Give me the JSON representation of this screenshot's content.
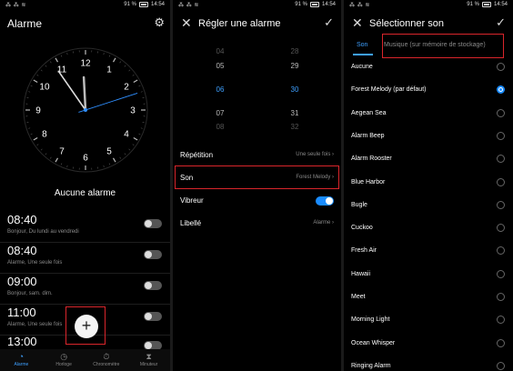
{
  "status": {
    "signal_left": "⁂ ⁂ ≋",
    "battery_percent": "91 %",
    "time": "14:54"
  },
  "panel1": {
    "title": "Alarme",
    "clock": {
      "hour_labels": [
        "12",
        "1",
        "2",
        "3",
        "4",
        "5",
        "6",
        "7",
        "8",
        "9",
        "10",
        "11"
      ],
      "hour": 11,
      "minute": 54,
      "second": 12
    },
    "no_alarm": "Aucune alarme",
    "alarms": [
      {
        "time": "08:40",
        "detail": "Bonjour, Du lundi au vendredi"
      },
      {
        "time": "08:40",
        "detail": "Alarme, Une seule fois"
      },
      {
        "time": "09:00",
        "detail": "Bonjour, sam. dim."
      },
      {
        "time": "11:00",
        "detail": "Alarme, Une seule fois"
      },
      {
        "time": "13:00",
        "detail": ""
      }
    ],
    "fab_label": "+",
    "nav": [
      {
        "label": "Alarme",
        "icon": "◔"
      },
      {
        "label": "Horloge",
        "icon": "◷"
      },
      {
        "label": "Chronomètre",
        "icon": "⏱"
      },
      {
        "label": "Minuteur",
        "icon": "⧗"
      }
    ]
  },
  "panel2": {
    "title": "Régler une alarme",
    "picker_hours": [
      "04",
      "05",
      "06",
      "07",
      "08"
    ],
    "picker_minutes": [
      "28",
      "29",
      "30",
      "31",
      "32"
    ],
    "settings": {
      "repetition_label": "Répétition",
      "repetition_value": "Une seule fois",
      "son_label": "Son",
      "son_value": "Forest Melody",
      "vibreur_label": "Vibreur",
      "libelle_label": "Libellé",
      "libelle_value": "Alarme"
    }
  },
  "panel3": {
    "title": "Sélectionner son",
    "tab_son": "Son",
    "tab_music": "Musique (sur mémoire de stockage)",
    "sounds": [
      "Aucune",
      "Forest Melody (par défaut)",
      "Aegean Sea",
      "Alarm Beep",
      "Alarm Rooster",
      "Blue Harbor",
      "Bugle",
      "Cuckoo",
      "Fresh Air",
      "Hawaii",
      "Meet",
      "Morning Light",
      "Ocean Whisper",
      "Ringing Alarm"
    ],
    "selected_index": 1
  },
  "colors": {
    "accent": "#1a8cff",
    "highlight_box": "#d9252b"
  }
}
